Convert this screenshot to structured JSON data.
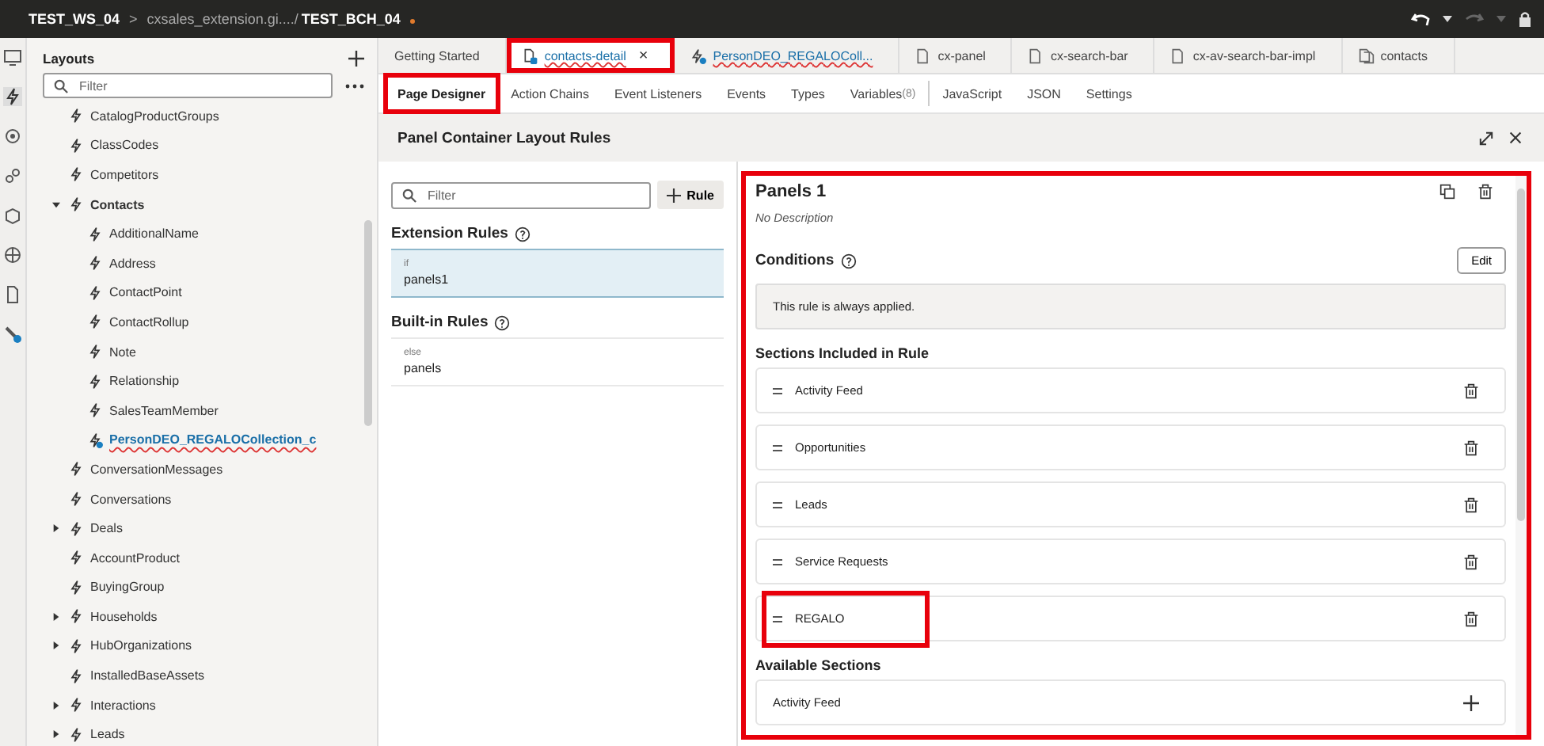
{
  "header": {
    "workspace": "TEST_WS_04",
    "separator": ">",
    "path": "cxsales_extension.gi..../",
    "branch": "TEST_BCH_04",
    "unsaved": true
  },
  "sidebar": {
    "title": "Layouts",
    "filter_placeholder": "Filter",
    "tree": [
      {
        "name": "CatalogProductGroups",
        "linked": false
      },
      {
        "name": "ClassCodes",
        "linked": false
      },
      {
        "name": "Competitors",
        "linked": false
      },
      {
        "name": "Contacts",
        "linked": false,
        "expanded": true,
        "children": [
          {
            "name": "AdditionalName",
            "linked": false
          },
          {
            "name": "Address",
            "linked": false
          },
          {
            "name": "ContactPoint",
            "linked": false
          },
          {
            "name": "ContactRollup",
            "linked": false
          },
          {
            "name": "Note",
            "linked": false
          },
          {
            "name": "Relationship",
            "linked": false
          },
          {
            "name": "SalesTeamMember",
            "linked": false
          },
          {
            "name": "PersonDEO_REGALOCollection_c",
            "linked": true
          }
        ]
      },
      {
        "name": "ConversationMessages",
        "linked": false
      },
      {
        "name": "Conversations",
        "linked": false
      },
      {
        "name": "Deals",
        "linked": false,
        "expanded": false
      },
      {
        "name": "AccountProduct",
        "linked": false
      },
      {
        "name": "BuyingGroup",
        "linked": false
      },
      {
        "name": "Households",
        "linked": false,
        "expanded": false
      },
      {
        "name": "HubOrganizations",
        "linked": false,
        "expanded": false
      },
      {
        "name": "InstalledBaseAssets",
        "linked": false
      },
      {
        "name": "Interactions",
        "linked": false,
        "expanded": false
      },
      {
        "name": "Leads",
        "linked": false,
        "expanded": false
      }
    ]
  },
  "tabs": [
    {
      "label": "Getting Started",
      "kind": "plain",
      "selected": false,
      "highlighted": false
    },
    {
      "label": "contacts-detail",
      "kind": "extension",
      "selected": true,
      "highlighted": true,
      "close": "×"
    },
    {
      "label": "PersonDEO_REGALOColl...",
      "kind": "layout",
      "selected": false,
      "highlighted": false
    },
    {
      "label": "cx-panel",
      "kind": "file",
      "selected": false,
      "highlighted": false
    },
    {
      "label": "cx-search-bar",
      "kind": "file",
      "selected": false,
      "highlighted": false
    },
    {
      "label": "cx-av-search-bar-impl",
      "kind": "file",
      "selected": false,
      "highlighted": false
    },
    {
      "label": "contacts",
      "kind": "files",
      "selected": false,
      "highlighted": false
    }
  ],
  "subtabs": [
    {
      "label": "Page Designer",
      "selected": true,
      "highlighted": true
    },
    {
      "label": "Action Chains",
      "selected": false,
      "highlighted": false
    },
    {
      "label": "Event Listeners",
      "selected": false,
      "highlighted": false
    },
    {
      "label": "Events",
      "selected": false,
      "highlighted": false
    },
    {
      "label": "Types",
      "selected": false,
      "highlighted": false
    },
    {
      "label": "Variables",
      "count": "(8)",
      "selected": false,
      "highlighted": false
    },
    {
      "label": "JavaScript",
      "selected": false,
      "highlighted": false
    },
    {
      "label": "JSON",
      "selected": false,
      "highlighted": false
    },
    {
      "label": "Settings",
      "selected": false,
      "highlighted": false
    }
  ],
  "editor": {
    "title": "Panel Container Layout Rules",
    "rules": {
      "filter_placeholder": "Filter",
      "add_button": "Rule",
      "groups": [
        {
          "title": "Extension Rules",
          "items": [
            {
              "condition": "if",
              "name": "panels1",
              "selected": true
            }
          ]
        },
        {
          "title": "Built-in Rules",
          "items": [
            {
              "condition": "else",
              "name": "panels",
              "selected": false
            }
          ]
        }
      ]
    },
    "detail": {
      "highlighted": true,
      "title": "Panels 1",
      "description": "No Description",
      "conditions_title": "Conditions",
      "edit_button": "Edit",
      "condition_text": "This rule is always applied.",
      "sections_title": "Sections Included in Rule",
      "sections": [
        {
          "name": "Activity Feed",
          "highlighted": false
        },
        {
          "name": "Opportunities",
          "highlighted": false
        },
        {
          "name": "Leads",
          "highlighted": false
        },
        {
          "name": "Service Requests",
          "highlighted": false
        },
        {
          "name": "REGALO",
          "highlighted": true
        }
      ],
      "available_title": "Available Sections",
      "available": [
        {
          "name": "Activity Feed"
        }
      ]
    }
  }
}
